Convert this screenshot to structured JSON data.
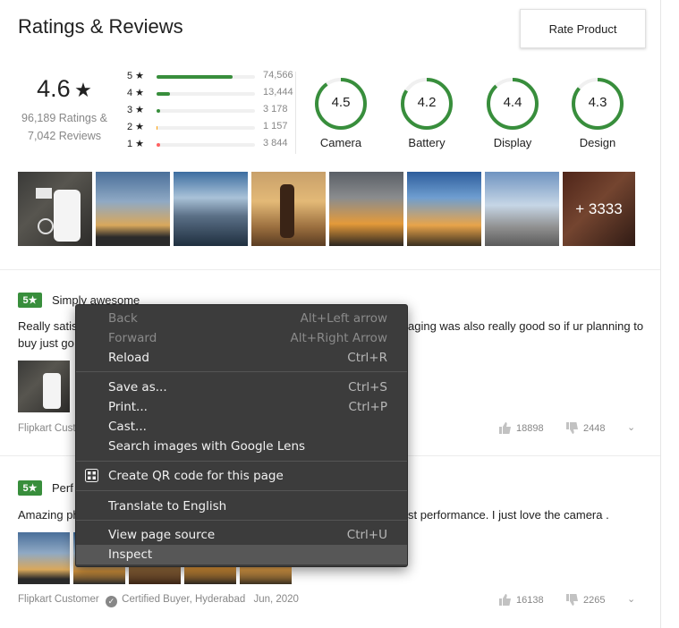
{
  "header": {
    "title": "Ratings & Reviews",
    "rate_button": "Rate Product"
  },
  "summary": {
    "average": "4.6",
    "star": "★",
    "ratings_text": "96,189 Ratings &",
    "reviews_text": "7,042 Reviews",
    "distribution": [
      {
        "label": "5 ★",
        "count": "74,566",
        "fraction": 0.775,
        "color": "#388e3c"
      },
      {
        "label": "4 ★",
        "count": "13,444",
        "fraction": 0.14,
        "color": "#388e3c"
      },
      {
        "label": "3 ★",
        "count": "3 178",
        "fraction": 0.033,
        "color": "#388e3c"
      },
      {
        "label": "2 ★",
        "count": "1 157",
        "fraction": 0.012,
        "color": "#ff9f00"
      },
      {
        "label": "1 ★",
        "count": "3 844",
        "fraction": 0.04,
        "color": "#ff6161"
      }
    ],
    "aspects": [
      {
        "value": "4.5",
        "label": "Camera",
        "fraction": 0.9
      },
      {
        "value": "4.2",
        "label": "Battery",
        "fraction": 0.84
      },
      {
        "value": "4.4",
        "label": "Display",
        "fraction": 0.88
      },
      {
        "value": "4.3",
        "label": "Design",
        "fraction": 0.86
      }
    ],
    "more_photos": "+ 3333"
  },
  "reviews": [
    {
      "rating": "5★",
      "title": "Simply awesome",
      "body_line1": "Really satis",
      "body_line1_end": "aging was also really good so if ur planning to",
      "body_line2": "buy just go",
      "author": "Flipkart Custo",
      "likes": "18898",
      "dislikes": "2448"
    },
    {
      "rating": "5★",
      "title": "Perf",
      "body_line1": "Amazing ph",
      "body_line1_end": "st performance. I just love the camera .",
      "author": "Flipkart Customer",
      "certified": "Certified Buyer, Hyderabad",
      "date": "Jun, 2020",
      "likes": "16138",
      "dislikes": "2265"
    }
  ],
  "context_menu": {
    "items": [
      {
        "label": "Back",
        "shortcut": "Alt+Left arrow",
        "disabled": true
      },
      {
        "label": "Forward",
        "shortcut": "Alt+Right Arrow",
        "disabled": true
      },
      {
        "label": "Reload",
        "shortcut": "Ctrl+R"
      },
      {
        "label": "Save as...",
        "shortcut": "Ctrl+S"
      },
      {
        "label": "Print...",
        "shortcut": "Ctrl+P"
      },
      {
        "label": "Cast...",
        "shortcut": ""
      },
      {
        "label": "Search images with Google Lens",
        "shortcut": ""
      },
      {
        "label": "Create QR code for this page",
        "shortcut": "",
        "icon": "qr-code-icon"
      },
      {
        "label": "Translate to English",
        "shortcut": ""
      },
      {
        "label": "View page source",
        "shortcut": "Ctrl+U"
      },
      {
        "label": "Inspect",
        "shortcut": "",
        "highlighted": true
      }
    ]
  },
  "icons": [
    "star-icon",
    "check-icon",
    "thumbs-up-icon",
    "thumbs-down-icon",
    "chevron-down-icon",
    "qr-code-icon"
  ]
}
